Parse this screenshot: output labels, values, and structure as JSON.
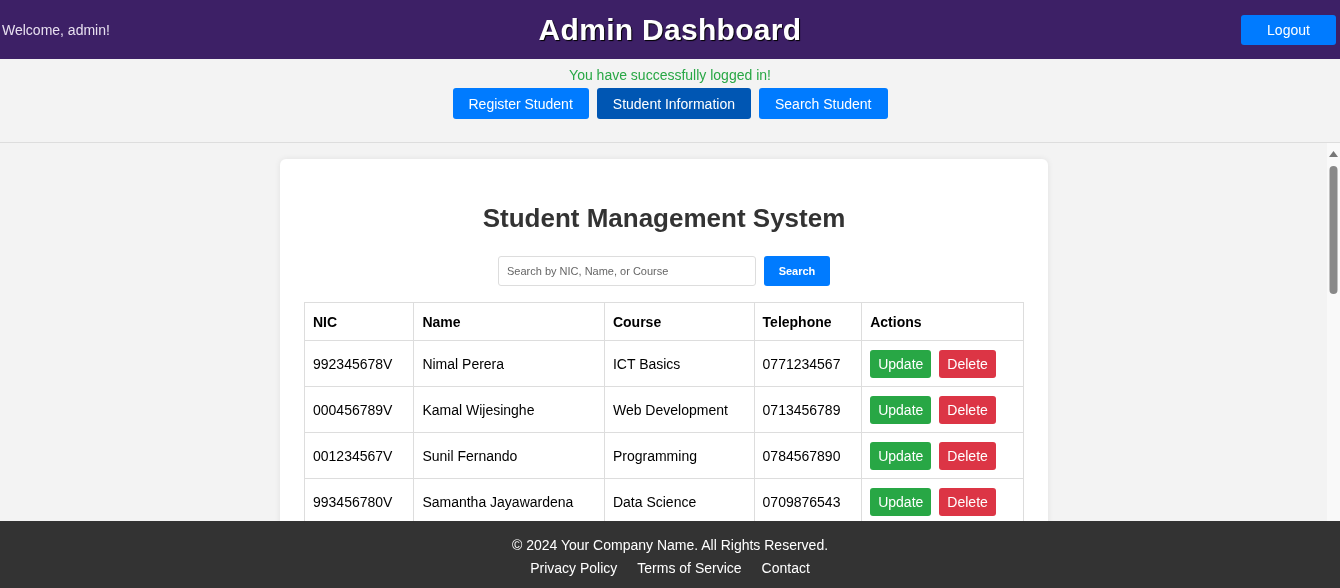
{
  "header": {
    "welcome": "Welcome, admin!",
    "title": "Admin Dashboard",
    "logout": "Logout"
  },
  "message": "You have successfully logged in!",
  "nav": [
    {
      "label": "Register Student",
      "selected": false
    },
    {
      "label": "Student Information",
      "selected": true
    },
    {
      "label": "Search Student",
      "selected": false
    }
  ],
  "card": {
    "title": "Student Management System",
    "search": {
      "placeholder": "Search by NIC, Name, or Course",
      "button": "Search"
    },
    "table": {
      "columns": [
        "NIC",
        "Name",
        "Course",
        "Telephone",
        "Actions"
      ],
      "rows": [
        {
          "cells": [
            "992345678V",
            "Nimal Perera",
            "ICT Basics",
            "0771234567"
          ],
          "actions": [
            "Update",
            "Delete"
          ]
        },
        {
          "cells": [
            "000456789V",
            "Kamal Wijesinghe",
            "Web Development",
            "0713456789"
          ],
          "actions": [
            "Update",
            "Delete"
          ]
        },
        {
          "cells": [
            "001234567V",
            "Sunil Fernando",
            "Programming",
            "0784567890"
          ],
          "actions": [
            "Update",
            "Delete"
          ]
        },
        {
          "cells": [
            "993456780V",
            "Samantha Jayawardena",
            "Data Science",
            "0709876543"
          ],
          "actions": [
            "Update",
            "Delete"
          ]
        }
      ]
    }
  },
  "footer": {
    "copyright": "© 2024 Your Company Name. All Rights Reserved.",
    "links": [
      "Privacy Policy",
      "Terms of Service",
      "Contact"
    ]
  }
}
